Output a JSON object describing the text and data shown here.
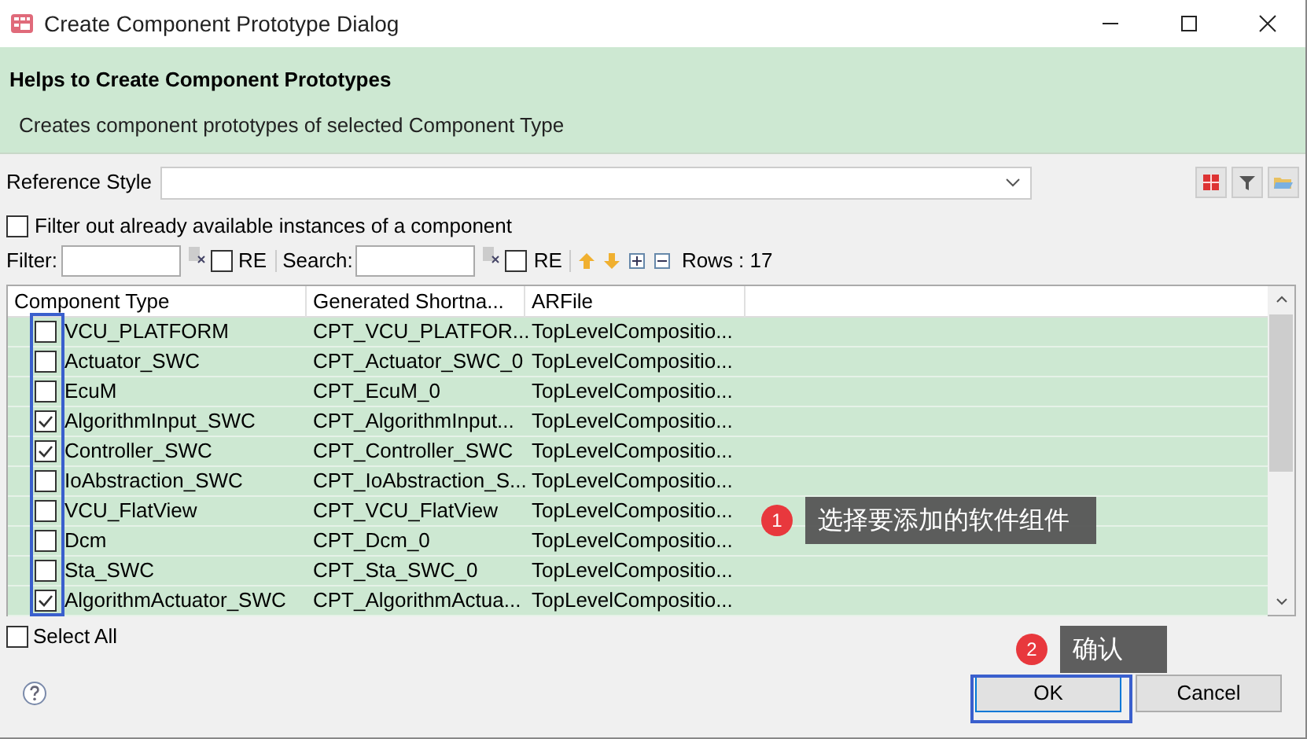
{
  "window": {
    "title": "Create Component Prototype Dialog"
  },
  "header": {
    "title": "Helps to Create Component Prototypes",
    "description": "Creates component prototypes of selected Component Type"
  },
  "reference_style": {
    "label": "Reference Style"
  },
  "filter_available": {
    "label": "Filter out already available instances of a component",
    "checked": false
  },
  "filter": {
    "label": "Filter:",
    "re_label": "RE",
    "re_checked": false
  },
  "search": {
    "label": "Search:",
    "re_label": "RE",
    "re_checked": false
  },
  "rows_count": "Rows : 17",
  "table": {
    "columns": [
      "Component Type",
      "Generated Shortna...",
      "ARFile"
    ],
    "rows": [
      {
        "checked": false,
        "cells": [
          "VCU_PLATFORM",
          "CPT_VCU_PLATFOR...",
          "TopLevelCompositio..."
        ]
      },
      {
        "checked": false,
        "cells": [
          "Actuator_SWC",
          "CPT_Actuator_SWC_0",
          "TopLevelCompositio..."
        ]
      },
      {
        "checked": false,
        "cells": [
          "EcuM",
          "CPT_EcuM_0",
          "TopLevelCompositio..."
        ]
      },
      {
        "checked": true,
        "cells": [
          "AlgorithmInput_SWC",
          "CPT_AlgorithmInput...",
          "TopLevelCompositio..."
        ]
      },
      {
        "checked": true,
        "cells": [
          "Controller_SWC",
          "CPT_Controller_SWC",
          "TopLevelCompositio..."
        ]
      },
      {
        "checked": false,
        "cells": [
          "IoAbstraction_SWC",
          "CPT_IoAbstraction_S...",
          "TopLevelCompositio..."
        ]
      },
      {
        "checked": false,
        "cells": [
          "VCU_FlatView",
          "CPT_VCU_FlatView",
          "TopLevelCompositio..."
        ]
      },
      {
        "checked": false,
        "cells": [
          "Dcm",
          "CPT_Dcm_0",
          "TopLevelCompositio..."
        ]
      },
      {
        "checked": false,
        "cells": [
          "Sta_SWC",
          "CPT_Sta_SWC_0",
          "TopLevelCompositio..."
        ]
      },
      {
        "checked": true,
        "cells": [
          "AlgorithmActuator_SWC",
          "CPT_AlgorithmActua...",
          "TopLevelCompositio..."
        ]
      }
    ]
  },
  "select_all": {
    "label": "Select All",
    "checked": false
  },
  "buttons": [
    "OK",
    "Cancel"
  ],
  "callouts": [
    {
      "number": "1",
      "text": "选择要添加的软件组件"
    },
    {
      "number": "2",
      "text": "确认"
    }
  ]
}
